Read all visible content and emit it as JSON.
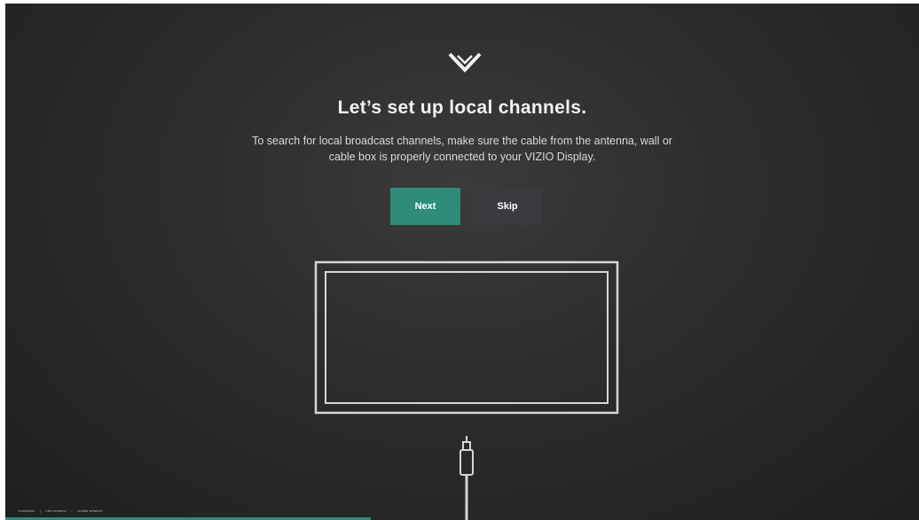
{
  "screen": {
    "title": "Let’s set up local channels.",
    "description": "To search for local broadcast channels, make sure the cable from the antenna, wall or cable box is properly connected to your VIZIO Display.",
    "logo_icon": "vizio-v-logo-icon",
    "illustration_icon": "tv-with-cable-icon"
  },
  "buttons": {
    "next_label": "Next",
    "skip_label": "Skip"
  },
  "footer": {
    "items": [
      "<modelId>",
      "|",
      "<fw version>",
      "|",
      "<initial version>"
    ]
  },
  "progress": {
    "fraction": 0.4
  },
  "colors": {
    "accent": "#2e8c79",
    "background": "#2b2b2b",
    "secondary_button": "#3a3b3f",
    "text": "#f2f2f2"
  }
}
